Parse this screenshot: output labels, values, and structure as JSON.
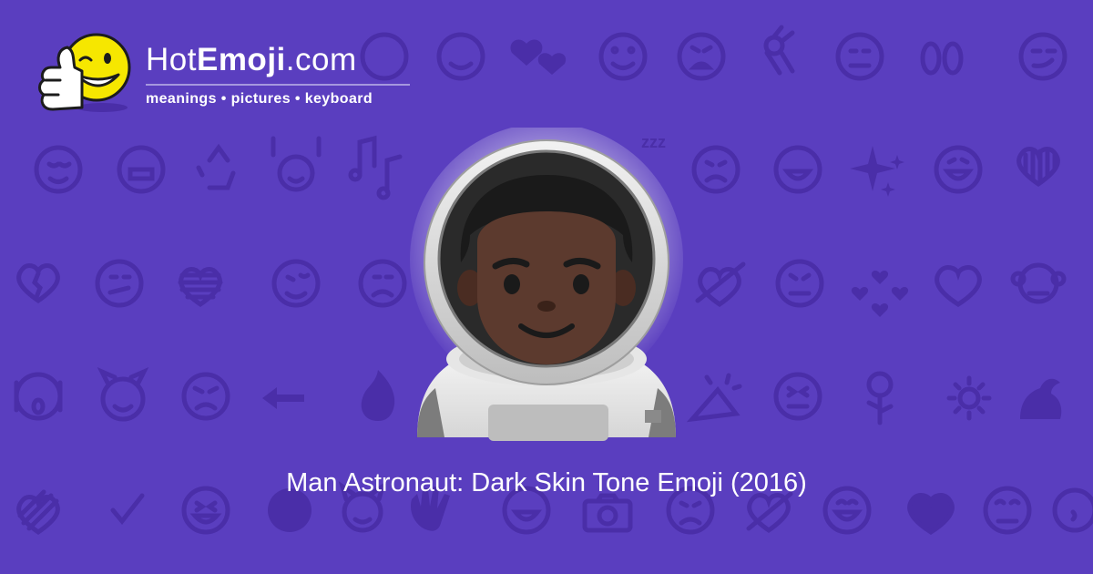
{
  "logo": {
    "title_regular": "Hot",
    "title_bold": "Emoji",
    "title_suffix": ".com",
    "tagline": "meanings • pictures • keyboard",
    "icon": "thumbs-up-winking-smiley-icon"
  },
  "hero": {
    "icon": "man-astronaut-dark-skin-tone-emoji",
    "caption": "Man Astronaut: Dark Skin Tone Emoji (2016)"
  },
  "background": {
    "color": "#5a3ebf",
    "pattern_color": "#4a2ea8",
    "pattern_glyph": "zzz",
    "icons": [
      "smiling-face-icon",
      "two-hearts-icon",
      "smiling-face-icon",
      "tired-face-icon",
      "ok-hand-icon",
      "neutral-face-icon",
      "eyes-icon",
      "smirking-face-icon",
      "relieved-face-icon",
      "grimacing-face-icon",
      "recycle-icon",
      "raising-hands-icon",
      "musical-notes-icon",
      "sleeping-zzz-icon",
      "worried-face-icon",
      "grinning-face-icon",
      "sparkles-icon",
      "grinning-face-icon",
      "striped-heart-icon",
      "broken-heart-icon",
      "confused-face-icon",
      "striped-heart-icon",
      "winking-tongue-face-icon",
      "frowning-face-icon",
      "heart-arrow-icon",
      "persevering-face-icon",
      "revolving-hearts-icon",
      "heart-icon",
      "monkey-icon",
      "screaming-face-icon",
      "smiling-devil-icon",
      "angry-face-icon",
      "left-arrow-icon",
      "fire-icon",
      "party-popper-icon",
      "squinting-tongue-face-icon",
      "rose-icon",
      "sun-icon",
      "flexed-biceps-icon",
      "striped-heart-icon",
      "check-mark-icon",
      "laughing-face-icon",
      "dark-face-icon",
      "heart-eyes-cat-icon",
      "waving-hand-icon",
      "grinning-face-icon",
      "camera-icon",
      "worried-face-icon",
      "heart-arrow-icon",
      "beaming-face-icon",
      "heart-icon",
      "rolling-eyes-face-icon",
      "kissing-face-icon"
    ]
  }
}
